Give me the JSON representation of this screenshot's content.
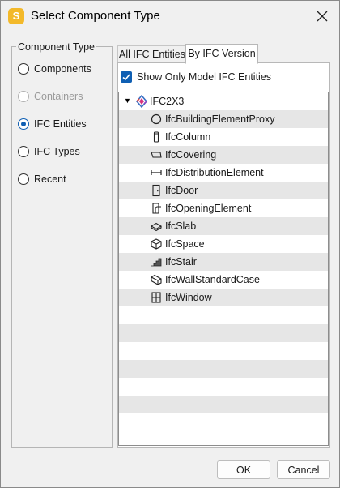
{
  "window": {
    "app_icon_letter": "S",
    "title": "Select Component Type",
    "close_icon": "close-icon"
  },
  "component_type": {
    "legend": "Component Type",
    "options": [
      {
        "label": "Components",
        "checked": false,
        "disabled": false
      },
      {
        "label": "Containers",
        "checked": false,
        "disabled": true
      },
      {
        "label": "IFC Entities",
        "checked": true,
        "disabled": false
      },
      {
        "label": "IFC Types",
        "checked": false,
        "disabled": false
      },
      {
        "label": "Recent",
        "checked": false,
        "disabled": false
      }
    ]
  },
  "tabs": [
    {
      "label": "All IFC Entities",
      "active": false
    },
    {
      "label": "By IFC Version",
      "active": true
    }
  ],
  "filter": {
    "label": "Show Only Model IFC Entities",
    "checked": true
  },
  "tree": {
    "root": {
      "label": "IFC2X3",
      "expanded": true,
      "icon": "ifc-schema-icon"
    },
    "items": [
      {
        "label": "IfcBuildingElementProxy",
        "icon": "proxy-circle-icon"
      },
      {
        "label": "IfcColumn",
        "icon": "column-icon"
      },
      {
        "label": "IfcCovering",
        "icon": "covering-icon"
      },
      {
        "label": "IfcDistributionElement",
        "icon": "distribution-element-icon"
      },
      {
        "label": "IfcDoor",
        "icon": "door-icon"
      },
      {
        "label": "IfcOpeningElement",
        "icon": "opening-element-icon"
      },
      {
        "label": "IfcSlab",
        "icon": "slab-icon"
      },
      {
        "label": "IfcSpace",
        "icon": "space-cube-icon"
      },
      {
        "label": "IfcStair",
        "icon": "stair-icon"
      },
      {
        "label": "IfcWallStandardCase",
        "icon": "wall-icon"
      },
      {
        "label": "IfcWindow",
        "icon": "window-icon"
      }
    ]
  },
  "buttons": {
    "ok": "OK",
    "cancel": "Cancel"
  }
}
